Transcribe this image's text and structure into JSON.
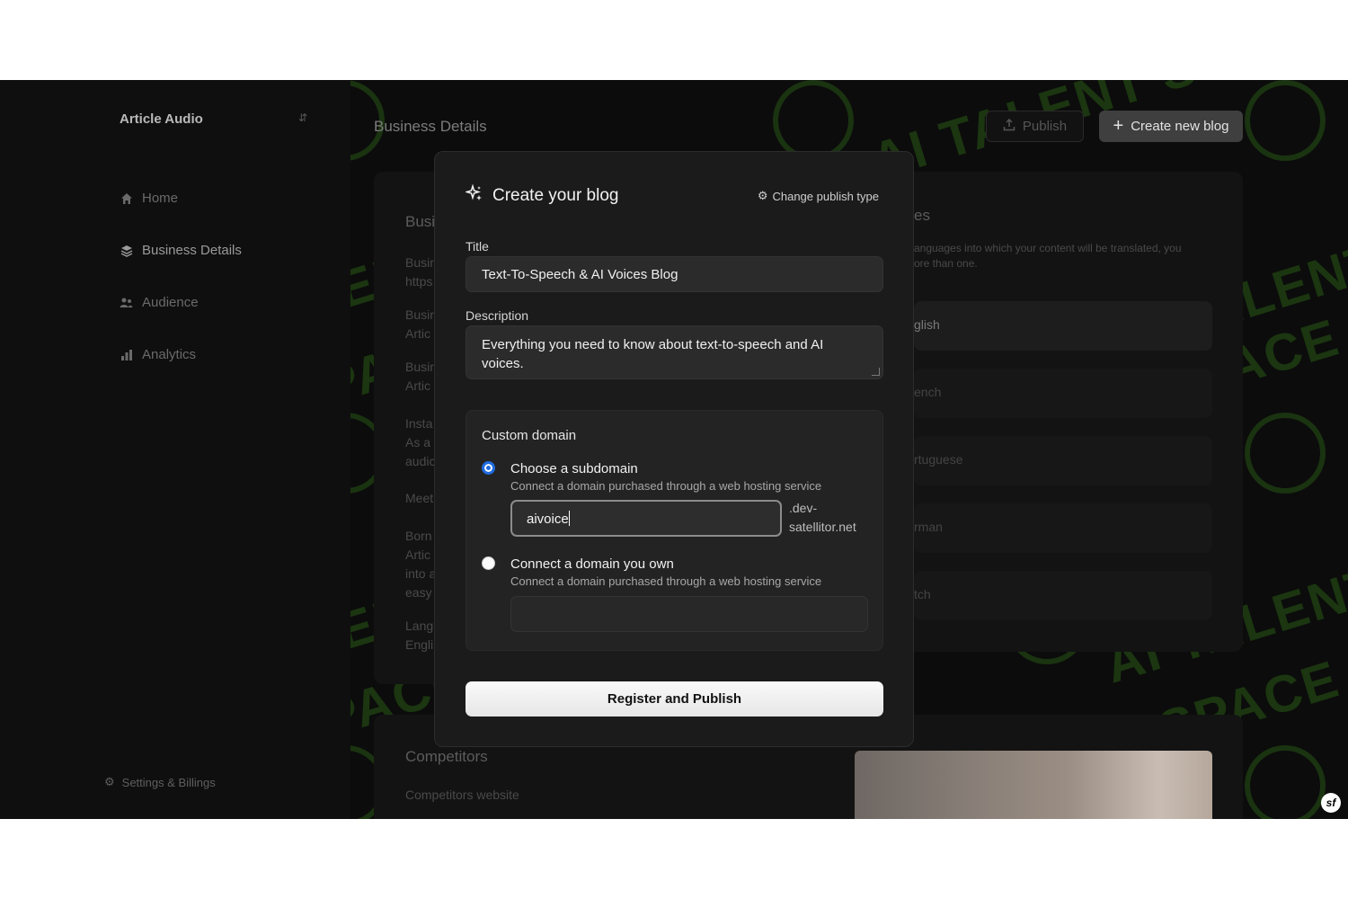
{
  "sidebar": {
    "brand": "Article Audio",
    "items": [
      {
        "label": "Home",
        "icon": "home-icon"
      },
      {
        "label": "Business Details",
        "icon": "layers-icon"
      },
      {
        "label": "Audience",
        "icon": "users-icon"
      },
      {
        "label": "Analytics",
        "icon": "bar-chart-icon"
      }
    ],
    "settings_label": "Settings & Billings"
  },
  "header": {
    "title": "Business Details",
    "publish_label": "Publish",
    "create_label": "Create new blog"
  },
  "background": {
    "left_card": {
      "heading": "Busi",
      "rows": [
        "Busir",
        "https",
        "Busir",
        "Artic",
        "Busir",
        "Artic",
        "Insta",
        "As a",
        "audic",
        "Meet",
        "Born",
        "Artic",
        "into a",
        "easy",
        "Lang",
        "Engli"
      ]
    },
    "right_card": {
      "heading": "es",
      "desc_line1": "anguages into which your content will be translated, you",
      "desc_line2": "ore than one.",
      "languages": [
        "glish",
        "ench",
        "rtuguese",
        "rman",
        "tch"
      ]
    },
    "competitors": {
      "heading": "Competitors",
      "field_label": "Competitors website"
    },
    "watermark_text": "AI TALENT SPACE"
  },
  "modal": {
    "title": "Create your blog",
    "change_type": "Change publish type",
    "title_label": "Title",
    "title_value": "Text-To-Speech & AI Voices Blog",
    "description_label": "Description",
    "description_value": "Everything you need to know about text-to-speech and AI voices.",
    "custom_domain_label": "Custom domain",
    "option_subdomain": {
      "title": "Choose a subdomain",
      "subtitle": "Connect a domain purchased through a web hosting service",
      "value": "aivoice",
      "suffix": ".dev-satellitor.net",
      "selected": true
    },
    "option_own": {
      "title": "Connect a domain you own",
      "subtitle": "Connect a domain purchased through a web hosting service",
      "value": "",
      "selected": false
    },
    "submit_label": "Register and Publish"
  }
}
